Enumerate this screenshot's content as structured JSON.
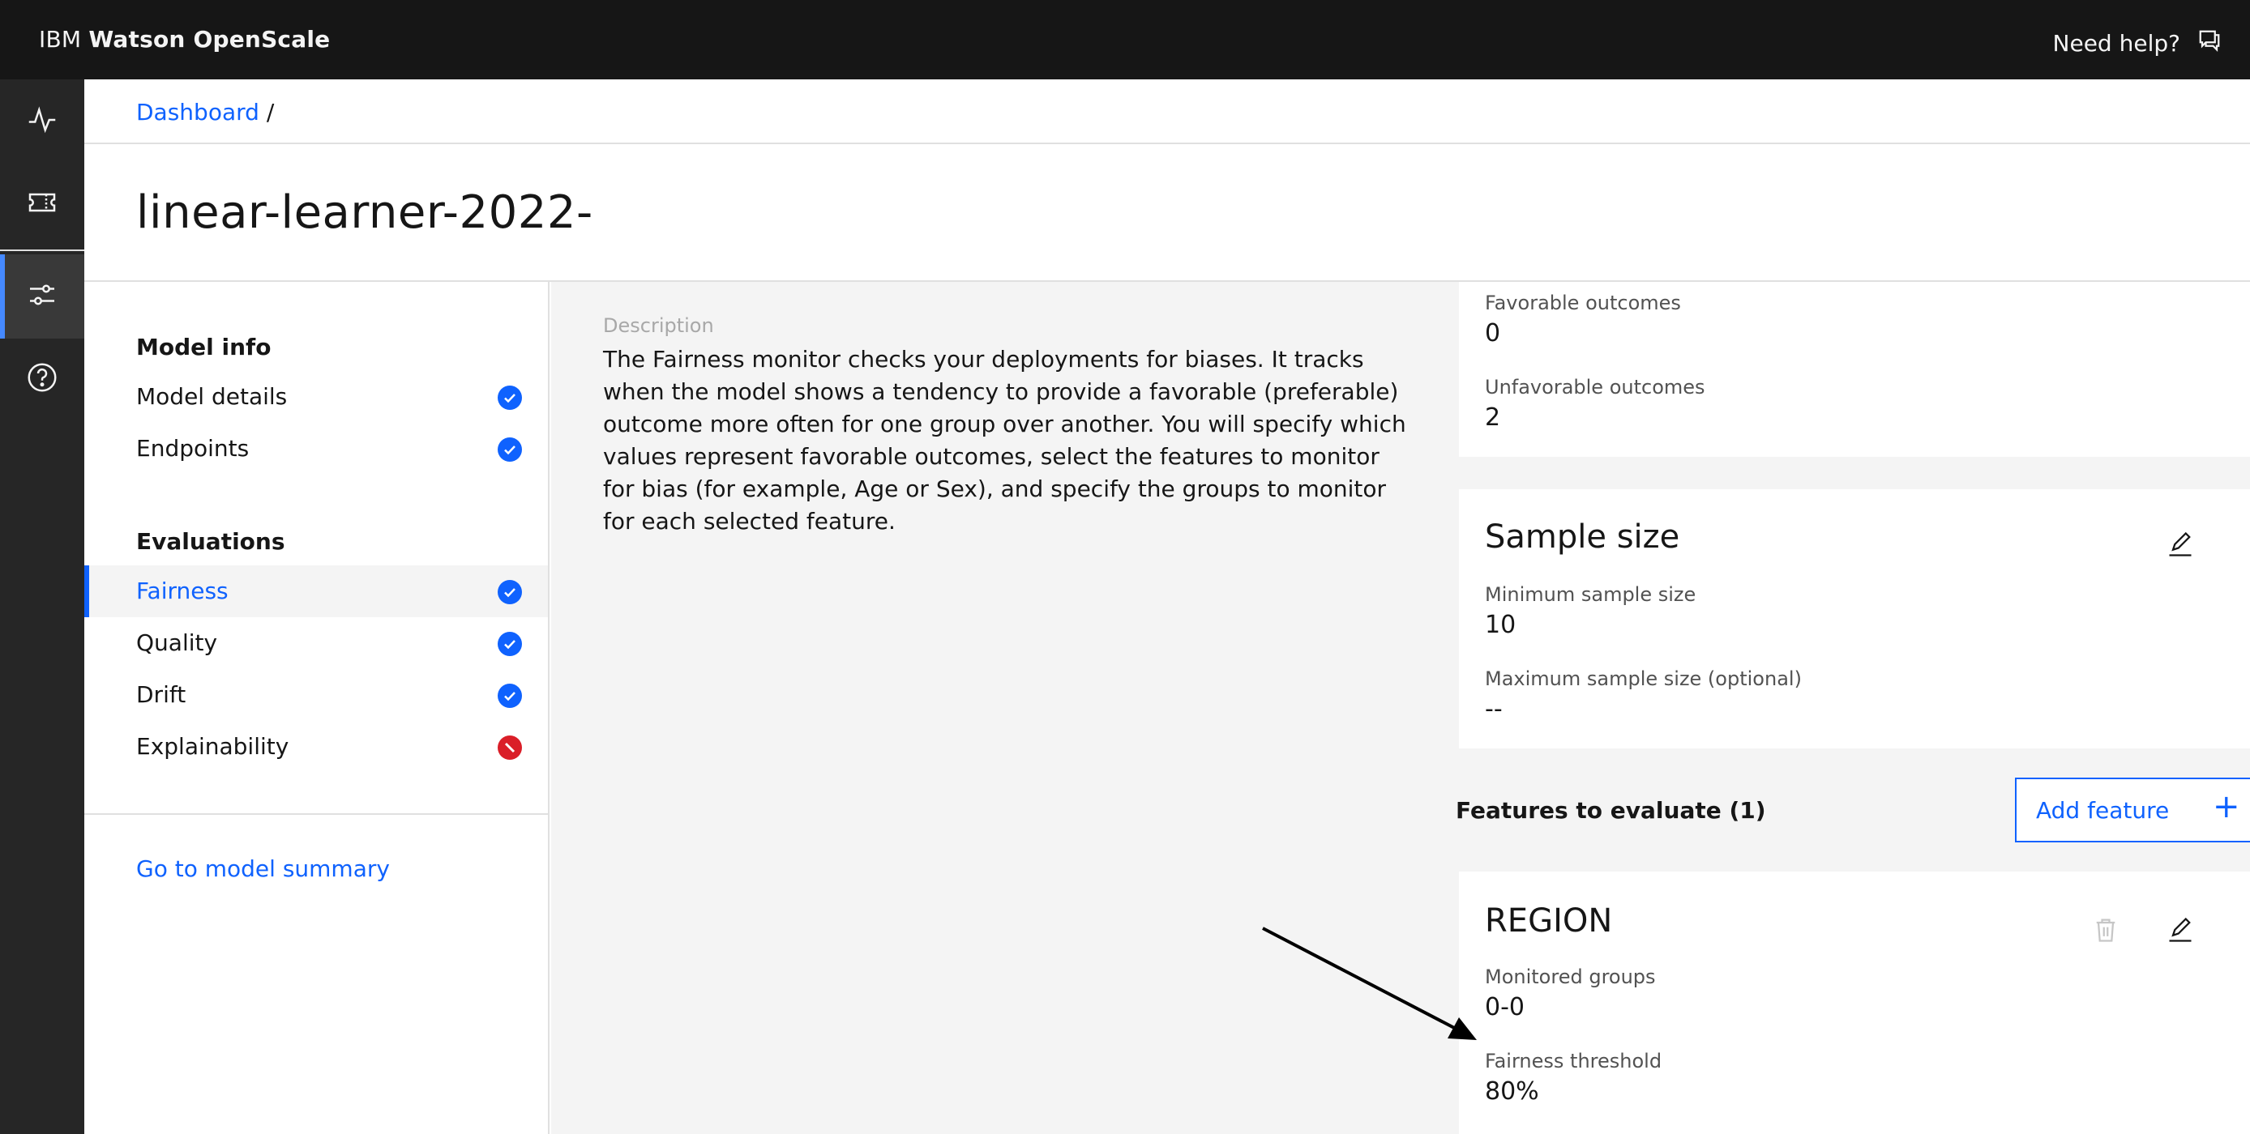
{
  "header": {
    "brand_prefix": "IBM",
    "brand_name": "Watson OpenScale",
    "help_label": "Need help?"
  },
  "rail": {
    "items": [
      {
        "name": "activity-icon"
      },
      {
        "name": "ticket-icon"
      },
      {
        "name": "settings-adjust-icon"
      },
      {
        "name": "help-icon"
      }
    ]
  },
  "breadcrumb": {
    "link": "Dashboard",
    "sep": "/"
  },
  "page": {
    "title": "linear-learner-2022-"
  },
  "sidenav": {
    "model_info_heading": "Model info",
    "model_info_items": [
      {
        "label": "Model details",
        "status": "complete"
      },
      {
        "label": "Endpoints",
        "status": "complete"
      }
    ],
    "evaluations_heading": "Evaluations",
    "evaluation_items": [
      {
        "label": "Fairness",
        "status": "complete",
        "active": true
      },
      {
        "label": "Quality",
        "status": "complete"
      },
      {
        "label": "Drift",
        "status": "complete"
      },
      {
        "label": "Explainability",
        "status": "disabled"
      }
    ],
    "summary_link": "Go to model summary"
  },
  "main": {
    "description_label": "Description",
    "description_text": "The Fairness monitor checks your deployments for biases. It tracks when the model shows a tendency to provide a favorable (preferable) outcome more often for one group over another. You will specify which values represent favorable outcomes, select the features to monitor for bias (for example, Age or Sex), and specify the groups to monitor for each selected feature.",
    "outcomes_card": {
      "favorable_label": "Favorable outcomes",
      "favorable_value": "0",
      "unfavorable_label": "Unfavorable outcomes",
      "unfavorable_value": "2"
    },
    "sample_size_card": {
      "title": "Sample size",
      "min_label": "Minimum sample size",
      "min_value": "10",
      "max_label": "Maximum sample size (optional)",
      "max_value": "--"
    },
    "features_heading": "Features to evaluate (1)",
    "add_feature_label": "Add feature",
    "add_feature_icon": "+",
    "feature_card": {
      "title": "REGION",
      "groups_label": "Monitored groups",
      "groups_value": "0-0",
      "threshold_label": "Fairness threshold",
      "threshold_value": "80%"
    }
  },
  "colors": {
    "header_bg": "#161616",
    "rail_bg": "#262626",
    "accent": "#0f62fe",
    "status_complete": "#0f62fe",
    "status_disabled": "#da1e28",
    "content_bg": "#f4f4f4"
  }
}
